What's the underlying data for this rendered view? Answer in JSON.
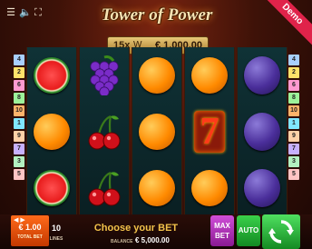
{
  "header": {
    "logo_text": "Tower of Power",
    "demo_label": "Demo",
    "menu_icon": "menu-icon",
    "sound_icon": "speaker-icon",
    "fullscreen_icon": "fullscreen-icon"
  },
  "lock_badge": {
    "multiplier": "15x",
    "icon": "w-icon",
    "amount": "€ 1,000.00"
  },
  "line_numbers": {
    "left": [
      "4",
      "2",
      "6",
      "8",
      "10",
      "1",
      "9",
      "7",
      "3",
      "5"
    ],
    "right": [
      "4",
      "2",
      "6",
      "8",
      "10",
      "1",
      "9",
      "7",
      "3",
      "5"
    ],
    "colors": [
      "#a8cfff",
      "#ffe36a",
      "#ff9ad0",
      "#9df29a",
      "#ffb36a",
      "#80e6ff",
      "#ffd1a8",
      "#c7b0ff",
      "#b2f0c0",
      "#ffc4c4"
    ]
  },
  "reels": [
    [
      "watermelon",
      "orange",
      "watermelon"
    ],
    [
      "grapes",
      "cherries",
      "cherries"
    ],
    [
      "orange",
      "orange",
      "orange"
    ],
    [
      "orange",
      "seven",
      "orange"
    ],
    [
      "plum",
      "plum",
      "plum"
    ]
  ],
  "controls": {
    "bet_value": "€ 1.00",
    "bet_label": "TOTAL BET",
    "lines_value": "10",
    "lines_label": "LINES",
    "message": "Choose your BET",
    "balance_label": "BALANCE",
    "balance_value": "€ 5,000.00",
    "max_bet": "MAX BET",
    "auto": "AUTO",
    "spin_icon": "spin-arrows-icon"
  },
  "colors": {
    "bet_orange": "#ff6a1a",
    "max_bet_purple": "#c043c8",
    "auto_green": "#22b034",
    "message_gold": "#f2c24a"
  }
}
